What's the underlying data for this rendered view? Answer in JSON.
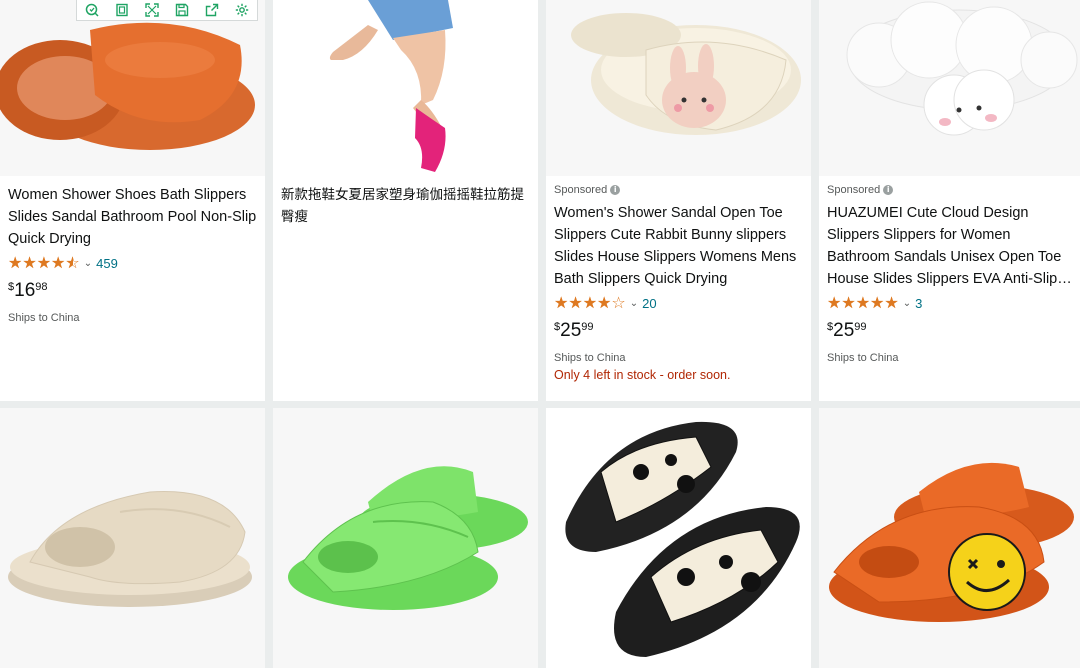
{
  "toolbar": {
    "icons": [
      "scan-icon",
      "copy-icon",
      "expand-icon",
      "save-icon",
      "share-icon",
      "settings-icon"
    ],
    "color": "#1fa463"
  },
  "products": [
    {
      "title": "Women Shower Shoes Bath Slippers Slides Sandal Bathroom Pool Non-Slip Quick Drying",
      "rating": 4.5,
      "reviews": "459",
      "price": {
        "symbol": "$",
        "whole": "16",
        "fraction": "98"
      },
      "ships": "Ships to China",
      "image": "orange-slide-slippers"
    },
    {
      "title": "新款拖鞋女夏居家塑身瑜伽摇摇鞋拉筋提臀瘦",
      "image": "pink-rocker-shoe-on-leg"
    },
    {
      "sponsored": "Sponsored",
      "title": "Women's Shower Sandal Open Toe Slippers Cute Rabbit Bunny slippers Slides House Slippers Womens Mens Bath Slippers Quick Drying",
      "rating": 4.0,
      "reviews": "20",
      "price": {
        "symbol": "$",
        "whole": "25",
        "fraction": "99"
      },
      "ships": "Ships to China",
      "stock": "Only 4 left in stock - order soon.",
      "image": "cream-bunny-slippers"
    },
    {
      "sponsored": "Sponsored",
      "title": "HUAZUMEI Cute Cloud Design Slippers Slippers for Women Bathroom Sandals Unisex Open Toe House Slides Slippers EVA Anti-Slip…",
      "rating": 5.0,
      "reviews": "3",
      "price": {
        "symbol": "$",
        "whole": "25",
        "fraction": "99"
      },
      "ships": "Ships to China",
      "image": "white-cloud-slippers"
    },
    {
      "image": "beige-slide-slipper"
    },
    {
      "image": "green-slide-slippers"
    },
    {
      "image": "black-cow-print-slides"
    },
    {
      "image": "orange-smiley-slides"
    }
  ],
  "colors": {
    "star": "#de7921",
    "link": "#007185",
    "stock": "#b12704",
    "muted": "#565959"
  }
}
